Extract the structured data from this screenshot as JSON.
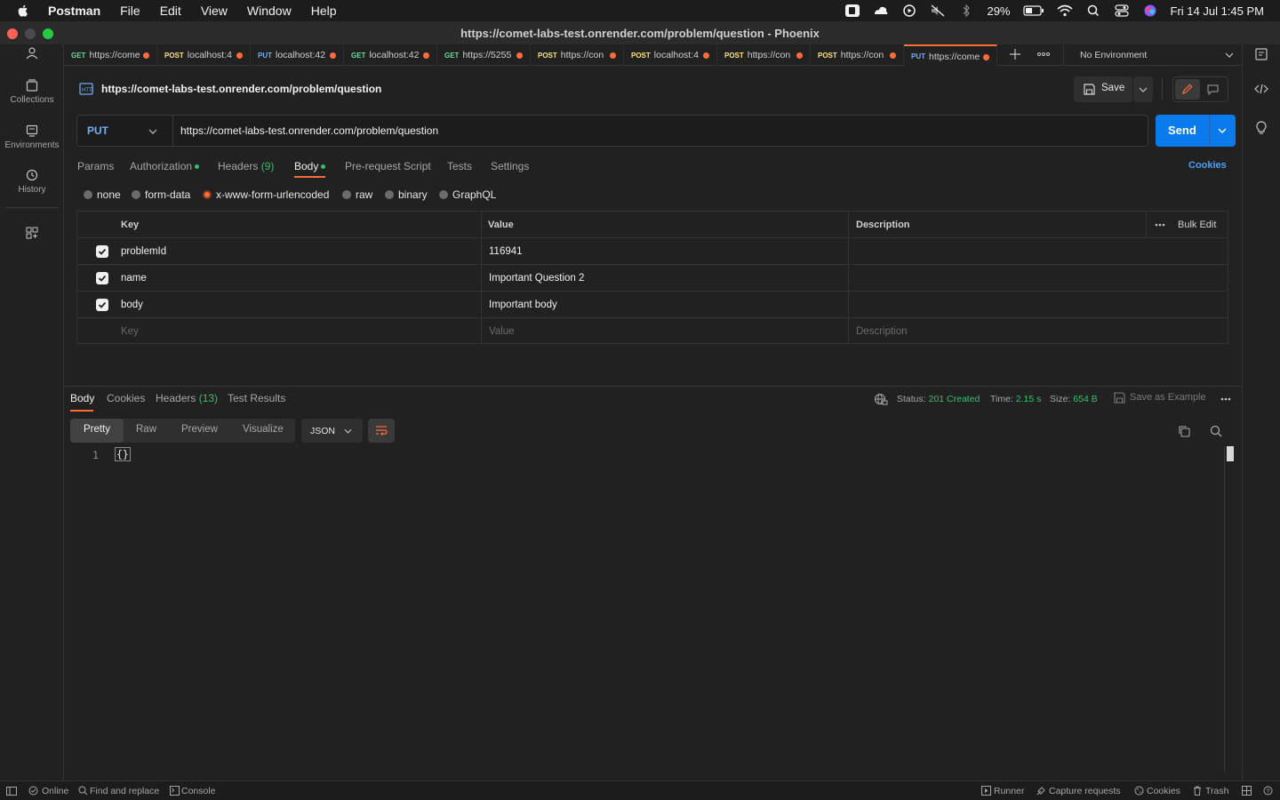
{
  "menubar": {
    "app": "Postman",
    "items": [
      "File",
      "Edit",
      "View",
      "Window",
      "Help"
    ],
    "battery": "29%",
    "datetime": "Fri 14 Jul  1:45 PM"
  },
  "window": {
    "title": "https://comet-labs-test.onrender.com/problem/question - Phoenix"
  },
  "sidebar": {
    "items": [
      {
        "label": "Collections",
        "icon": "collections-icon"
      },
      {
        "label": "Environments",
        "icon": "environments-icon"
      },
      {
        "label": "History",
        "icon": "history-icon"
      }
    ]
  },
  "tabs": [
    {
      "method": "GET",
      "url": "https://come"
    },
    {
      "method": "POST",
      "url": "localhost:4"
    },
    {
      "method": "PUT",
      "url": "localhost:42"
    },
    {
      "method": "GET",
      "url": "localhost:42"
    },
    {
      "method": "GET",
      "url": "https://5255"
    },
    {
      "method": "POST",
      "url": "https://con"
    },
    {
      "method": "POST",
      "url": "localhost:4"
    },
    {
      "method": "POST",
      "url": "https://con"
    },
    {
      "method": "POST",
      "url": "https://con"
    },
    {
      "method": "PUT",
      "url": "https://come"
    }
  ],
  "environment": {
    "selected": "No Environment"
  },
  "request": {
    "title": "https://comet-labs-test.onrender.com/problem/question",
    "save_label": "Save",
    "method": "PUT",
    "url": "https://comet-labs-test.onrender.com/problem/question",
    "send_label": "Send",
    "subtabs": {
      "params": "Params",
      "authorization": "Authorization",
      "headers": "Headers",
      "headers_count": "(9)",
      "body": "Body",
      "prerequest": "Pre-request Script",
      "tests": "Tests",
      "settings": "Settings",
      "cookies": "Cookies"
    },
    "body_types": [
      "none",
      "form-data",
      "x-www-form-urlencoded",
      "raw",
      "binary",
      "GraphQL"
    ],
    "body_type_selected": "x-www-form-urlencoded",
    "table": {
      "headers": {
        "key": "Key",
        "value": "Value",
        "description": "Description",
        "bulk_edit": "Bulk Edit"
      },
      "rows": [
        {
          "key": "problemId",
          "value": "116941",
          "checked": true
        },
        {
          "key": "name",
          "value": "Important Question 2",
          "checked": true
        },
        {
          "key": "body",
          "value": "Important body",
          "checked": true
        }
      ],
      "placeholder": {
        "key": "Key",
        "value": "Value",
        "description": "Description"
      }
    }
  },
  "response": {
    "tabs": {
      "body": "Body",
      "cookies": "Cookies",
      "headers": "Headers",
      "headers_count": "(13)",
      "tests": "Test Results"
    },
    "status_label": "Status:",
    "status_value": "201 Created",
    "time_label": "Time:",
    "time_value": "2.15 s",
    "size_label": "Size:",
    "size_value": "654 B",
    "save_example": "Save as Example",
    "views": [
      "Pretty",
      "Raw",
      "Preview",
      "Visualize"
    ],
    "format": "JSON",
    "line_number": "1",
    "content": "{}"
  },
  "statusbar": {
    "online": "Online",
    "find": "Find and replace",
    "console": "Console",
    "runner": "Runner",
    "capture": "Capture requests",
    "cookies": "Cookies",
    "trash": "Trash"
  }
}
